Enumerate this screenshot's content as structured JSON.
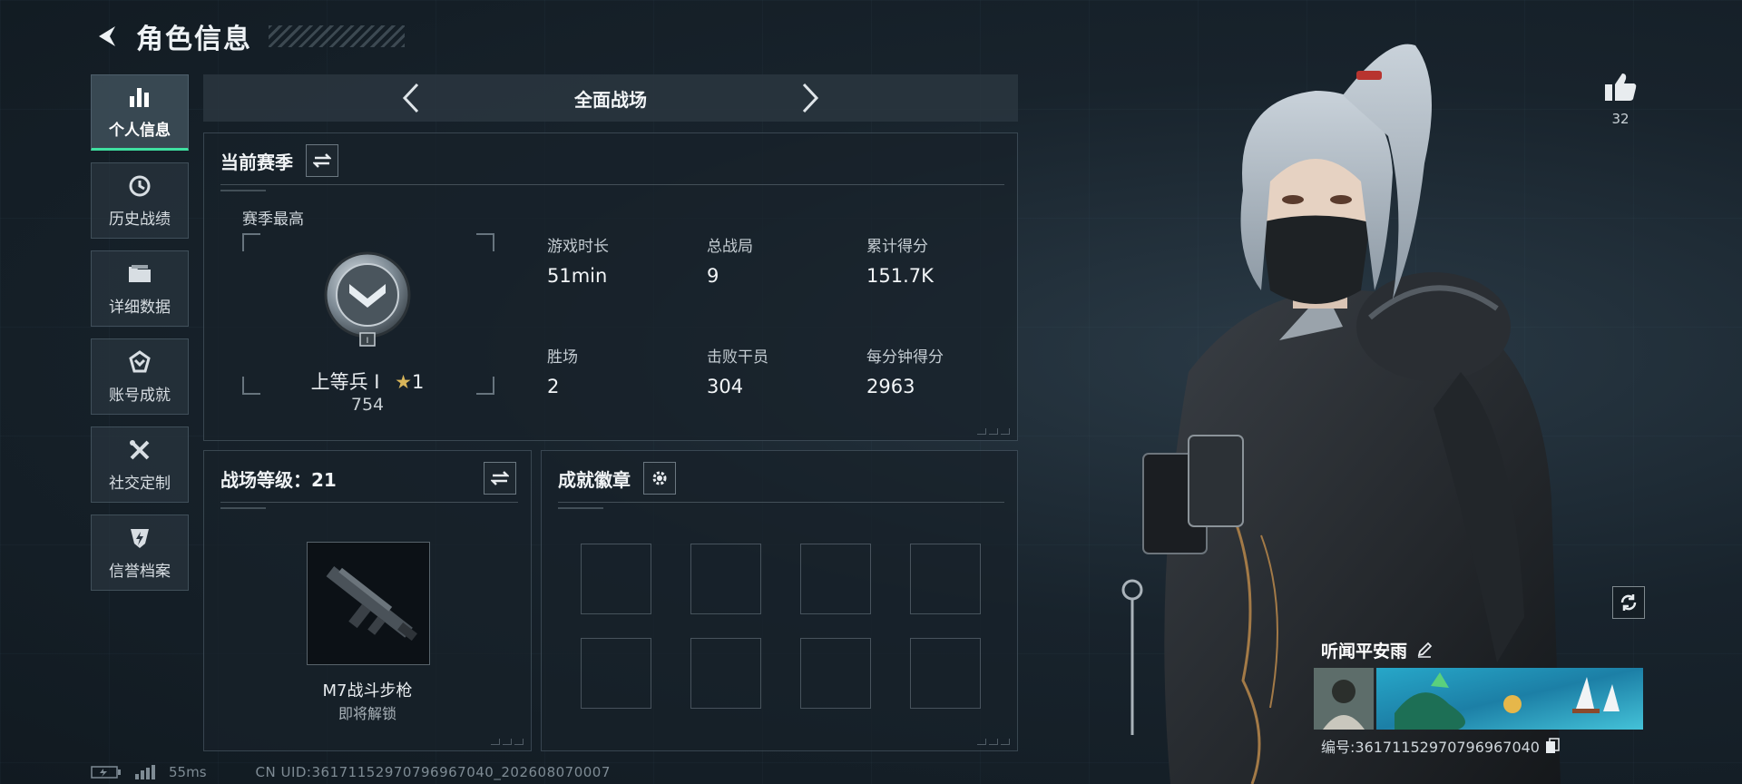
{
  "header": {
    "title": "角色信息"
  },
  "sidebar": {
    "items": [
      {
        "label": "个人信息",
        "icon": "bar-chart-icon",
        "active": true
      },
      {
        "label": "历史战绩",
        "icon": "history-clock-icon",
        "active": false
      },
      {
        "label": "详细数据",
        "icon": "folder-icon",
        "active": false
      },
      {
        "label": "账号成就",
        "icon": "achievement-emblem-icon",
        "active": false
      },
      {
        "label": "社交定制",
        "icon": "tools-icon",
        "active": false
      },
      {
        "label": "信誉档案",
        "icon": "shield-lightning-icon",
        "active": false
      }
    ]
  },
  "mode": {
    "title": "全面战场"
  },
  "season": {
    "title": "当前赛季",
    "best_label": "赛季最高",
    "rank_name": "上等兵 I",
    "rank_stars": "1",
    "rank_score": "754",
    "stats": [
      {
        "label": "游戏时长",
        "value": "51min"
      },
      {
        "label": "总战局",
        "value": "9"
      },
      {
        "label": "累计得分",
        "value": "151.7K"
      },
      {
        "label": "胜场",
        "value": "2"
      },
      {
        "label": "击败干员",
        "value": "304"
      },
      {
        "label": "每分钟得分",
        "value": "2963"
      }
    ]
  },
  "battlefield": {
    "title": "战场等级：21",
    "weapon_name": "M7战斗步枪",
    "weapon_status": "即将解锁"
  },
  "badges": {
    "title": "成就徽章",
    "slot_count": 8
  },
  "likes": {
    "count": "32"
  },
  "player_card": {
    "name": "听闻平安雨",
    "id_text": "编号:36171152970796967040"
  },
  "footer": {
    "ping": "55ms",
    "uid": "CN UID:36171152970796967040_202608070007"
  },
  "colors": {
    "accent": "#3fe0a0",
    "panel_bg": "#18212a",
    "text": "#e6eaee"
  }
}
